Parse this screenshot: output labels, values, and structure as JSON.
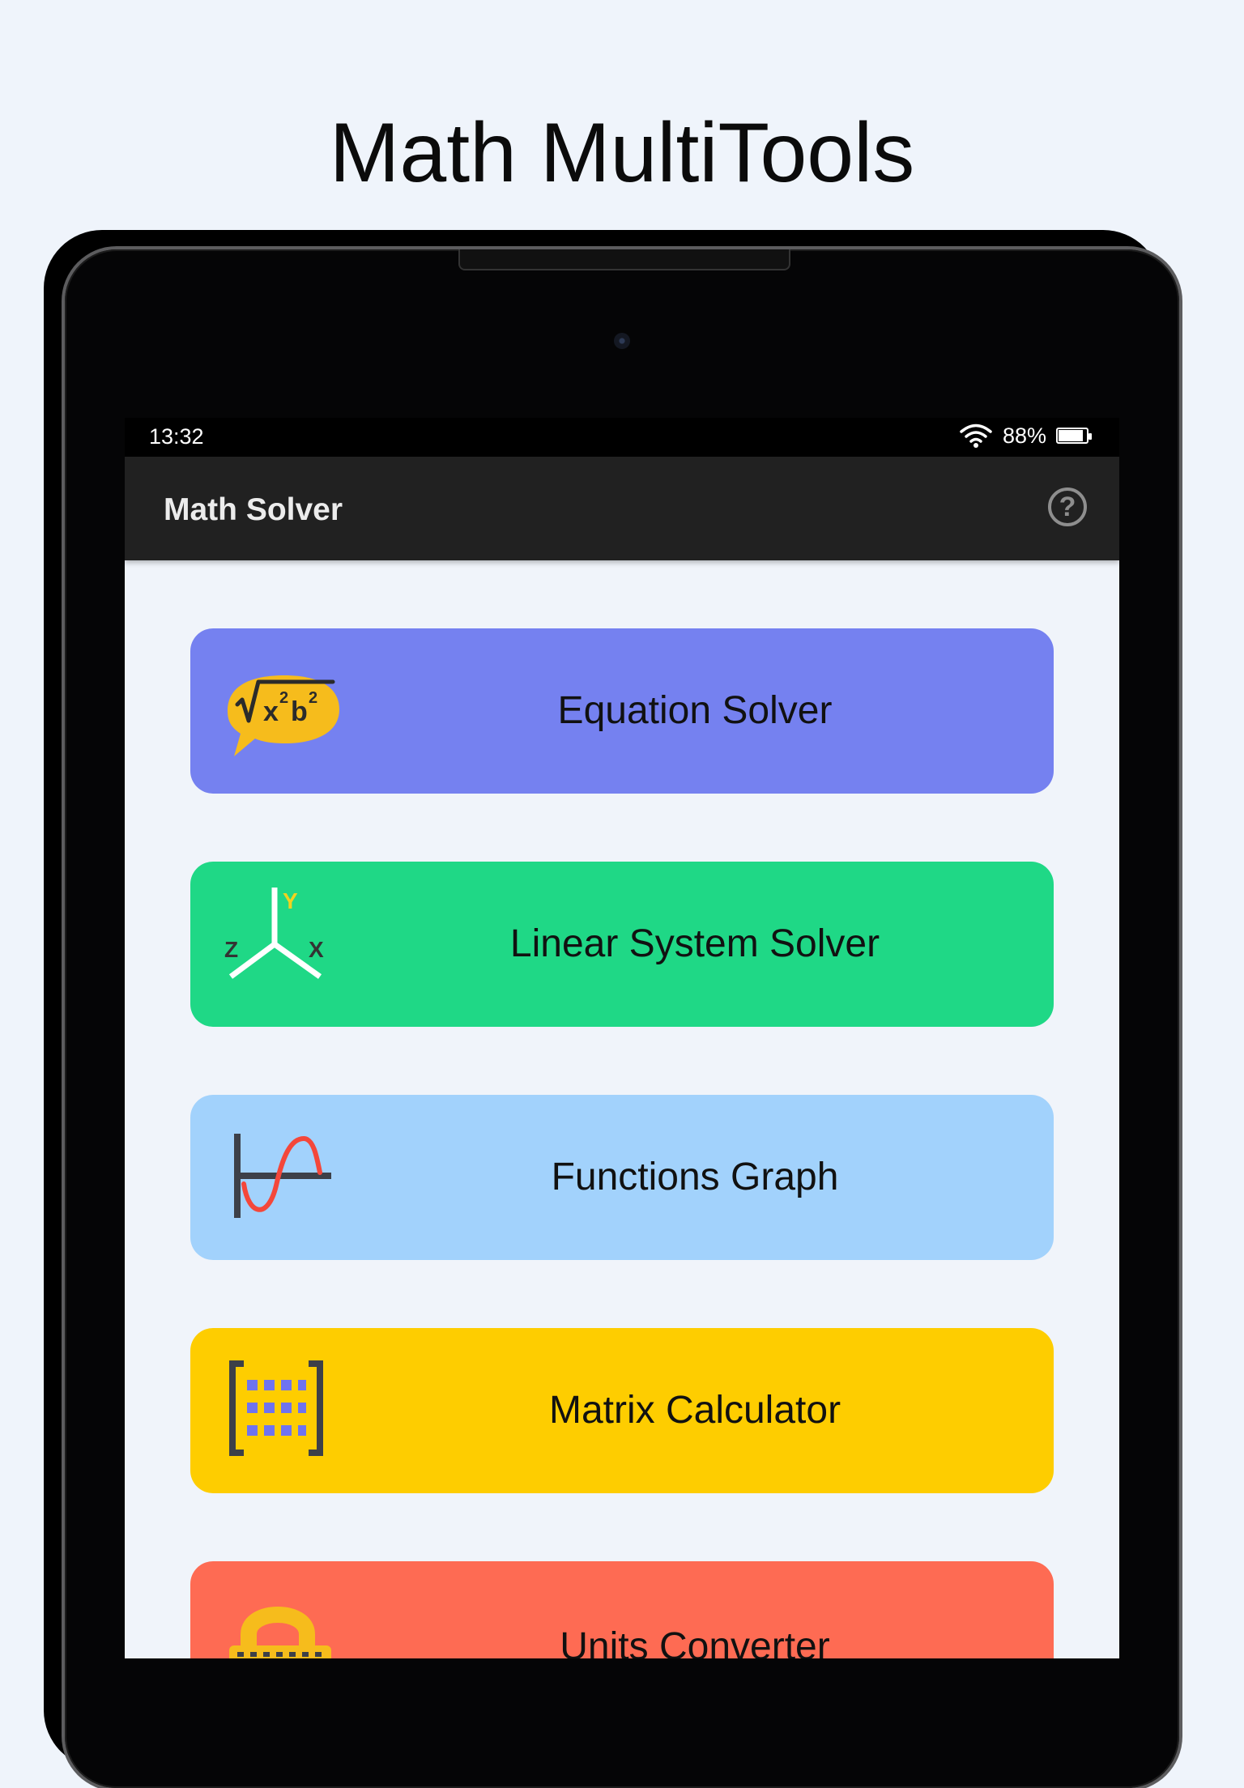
{
  "headline": "Math MultiTools",
  "status_bar": {
    "time": "13:32",
    "battery_percent": "88%",
    "battery_level": 0.88,
    "wifi_icon": "wifi-icon",
    "battery_icon": "battery-icon"
  },
  "app_bar": {
    "title": "Math Solver",
    "help_icon": "help-circle-icon",
    "help_glyph": "?"
  },
  "menu": [
    {
      "label": "Equation Solver",
      "icon": "equation-bubble-icon",
      "color": "#7581f0",
      "icon_text": {
        "root_x": "x",
        "sup1": "2",
        "b": "b",
        "sup2": "2"
      }
    },
    {
      "label": "Linear System Solver",
      "icon": "xyz-axes-icon",
      "color": "#1fd886",
      "icon_text": {
        "y": "Y",
        "z": "Z",
        "x": "X"
      }
    },
    {
      "label": "Functions Graph",
      "icon": "sine-graph-icon",
      "color": "#a2d2fc"
    },
    {
      "label": "Matrix Calculator",
      "icon": "matrix-brackets-icon",
      "color": "#fecd00"
    },
    {
      "label": "Units Converter",
      "icon": "units-converter-icon",
      "color": "#fe6b53"
    }
  ],
  "colors": {
    "page_background": "#eff4fb",
    "app_bar": "#212121",
    "status_bar": "#000000"
  }
}
